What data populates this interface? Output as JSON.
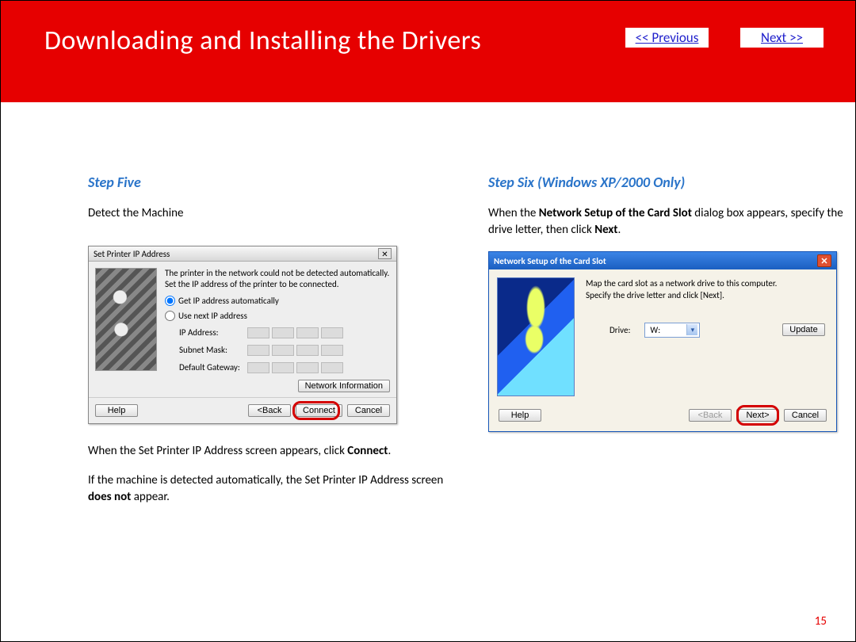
{
  "header": {
    "title": "Downloading and Installing  the Drivers",
    "prev": "<< Previous",
    "next": "Next >>"
  },
  "left": {
    "step_title": "Step Five",
    "intro": "Detect the Machine",
    "dialog": {
      "title": "Set Printer IP Address",
      "desc1": "The printer in the network could not be detected automatically.",
      "desc2": "Set the IP address of the printer to be connected.",
      "radio_auto": "Get IP address automatically",
      "radio_manual": "Use next IP address",
      "ip_label": "IP Address:",
      "subnet_label": "Subnet Mask:",
      "gateway_label": "Default Gateway:",
      "netinfo_btn": "Network Information",
      "help_btn": "Help",
      "back_btn": "<Back",
      "connect_btn": "Connect",
      "cancel_btn": "Cancel"
    },
    "para1_a": "When the Set Printer IP Address screen appears, click ",
    "para1_b": "Connect",
    "para1_c": ".",
    "para2_a": "If the machine is detected automatically, the Set Printer IP Address screen ",
    "para2_b": "does not",
    "para2_c": " appear."
  },
  "right": {
    "step_title": "Step Six (Windows XP/2000 Only)",
    "intro_a": "When the ",
    "intro_b": "Network Setup of the Card Slot",
    "intro_c": " dialog box appears, specify the drive letter, then click ",
    "intro_d": "Next",
    "intro_e": ".",
    "dialog": {
      "title": "Network Setup of the Card Slot",
      "desc1": "Map the card slot as a network drive to this computer.",
      "desc2": "Specify the drive letter and click [Next].",
      "drive_label": "Drive:",
      "drive_value": "W:",
      "update_btn": "Update",
      "help_btn": "Help",
      "back_btn": "<Back",
      "next_btn": "Next>",
      "cancel_btn": "Cancel"
    }
  },
  "page_number": "15"
}
